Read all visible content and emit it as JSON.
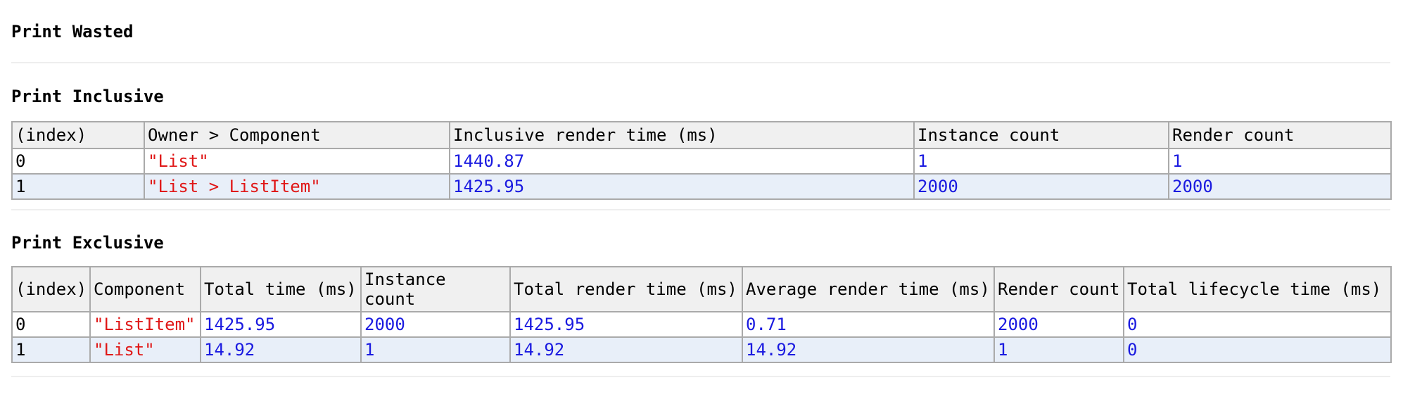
{
  "colors": {
    "string": "#e01818",
    "number": "#1a1ae0",
    "header_bg": "#f0f0f0",
    "alt_row_bg": "#e8eff9",
    "border": "#aaaaaa",
    "divider": "#eeeeee"
  },
  "wasted": {
    "title": "Print Wasted"
  },
  "inclusive": {
    "title": "Print Inclusive",
    "headers": [
      "(index)",
      "Owner > Component",
      "Inclusive render time (ms)",
      "Instance count",
      "Render count"
    ],
    "rows": [
      [
        "0",
        "\"List\"",
        "1440.87",
        "1",
        "1"
      ],
      [
        "1",
        "\"List > ListItem\"",
        "1425.95",
        "2000",
        "2000"
      ]
    ]
  },
  "exclusive": {
    "title": "Print Exclusive",
    "headers": [
      "(index)",
      "Component",
      "Total time (ms)",
      "Instance count",
      "Total render time (ms)",
      "Average render time (ms)",
      "Render count",
      "Total lifecycle time (ms)"
    ],
    "rows": [
      [
        "0",
        "\"ListItem\"",
        "1425.95",
        "2000",
        "1425.95",
        "0.71",
        "2000",
        "0"
      ],
      [
        "1",
        "\"List\"",
        "14.92",
        "1",
        "14.92",
        "14.92",
        "1",
        "0"
      ]
    ]
  }
}
